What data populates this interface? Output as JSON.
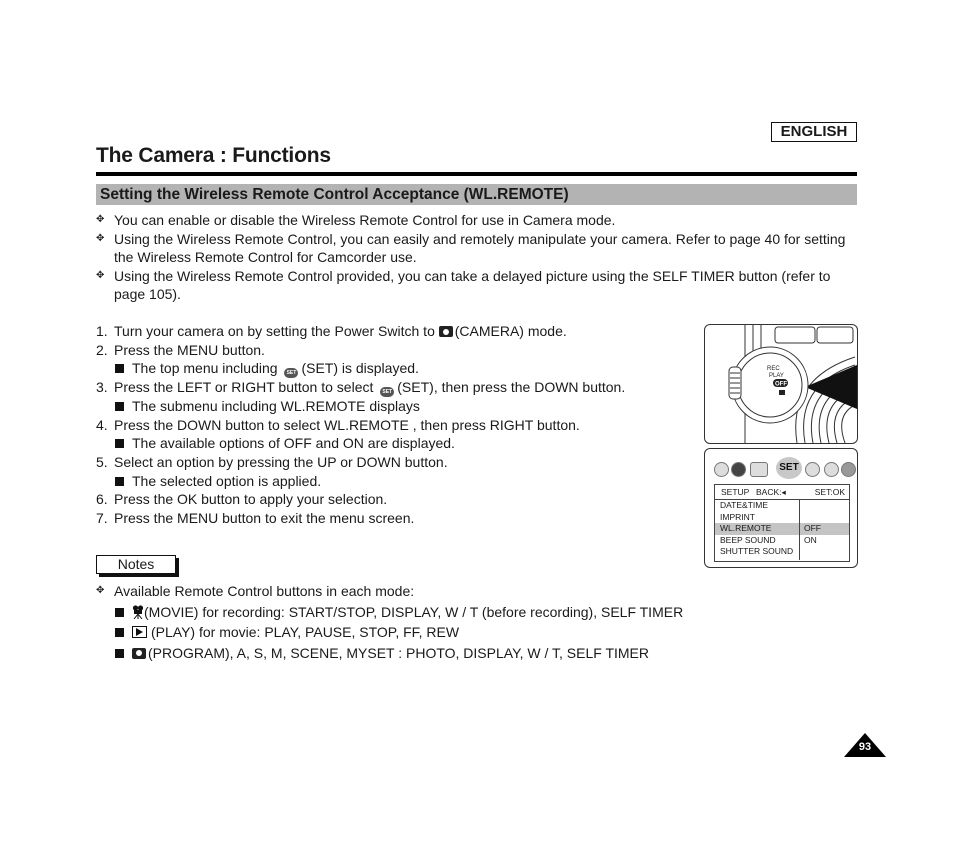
{
  "header": {
    "language_badge": "ENGLISH",
    "page_title": "The Camera : Functions",
    "section_title": "Setting the Wireless Remote Control Acceptance (WL.REMOTE)"
  },
  "intro_bullets": [
    "You can enable or disable the Wireless Remote Control for use in Camera mode.",
    "Using the Wireless Remote Control, you can easily and remotely manipulate your camera. Refer to page 40 for setting the Wireless Remote Control for Camcorder use.",
    "Using the Wireless Remote Control provided, you can take a delayed picture using the SELF TIMER button (refer to page 105)."
  ],
  "bullet_icon": "four-point-star-icon",
  "steps": [
    {
      "num": "1.",
      "pre": "Turn your camera on by setting the Power Switch to ",
      "icon": "camera-icon",
      "post": "(CAMERA) mode."
    },
    {
      "num": "2.",
      "text": "Press the MENU button."
    },
    {
      "sub": true,
      "pre": "The top menu including ",
      "icon": "set-icon",
      "post": "(SET) is displayed."
    },
    {
      "num": "3.",
      "pre": "Press the LEFT or RIGHT button to select ",
      "icon": "set-icon",
      "post": "(SET), then press the DOWN button."
    },
    {
      "sub": true,
      "text": "The submenu including  WL.REMOTE  displays"
    },
    {
      "num": "4.",
      "text": "Press the DOWN button to select  WL.REMOTE , then press RIGHT button."
    },
    {
      "sub": true,
      "text": "The available options of  OFF  and  ON  are displayed."
    },
    {
      "num": "5.",
      "text": "Select an option by pressing the UP or DOWN button."
    },
    {
      "sub": true,
      "text": "The selected option is applied."
    },
    {
      "num": "6.",
      "text": "Press the OK button to apply your selection."
    },
    {
      "num": "7.",
      "text": "Press the MENU button to exit the menu screen."
    }
  ],
  "set_icon_label": "SET",
  "notes": {
    "label": "Notes",
    "intro": "Available Remote Control buttons in each mode:",
    "items": [
      {
        "icon": "movie-camera-icon",
        "text": "(MOVIE) for recording: START/STOP, DISPLAY, W / T (before recording), SELF TIMER"
      },
      {
        "icon": "play-icon",
        "text": "(PLAY) for movie: PLAY, PAUSE, STOP, FF, REW"
      },
      {
        "icon": "camera-icon",
        "text": "(PROGRAM), A, S, M, SCENE, MYSET : PHOTO, DISPLAY, W / T, SELF TIMER"
      }
    ]
  },
  "camera_illustration": {
    "dial_labels": [
      "REC",
      "PLAY",
      "OFF"
    ]
  },
  "menu_screen": {
    "top_icons": [
      "camera-mode-icon",
      "self-timer-icon",
      "display-icon",
      "SET",
      "user-icon",
      "volume-icon",
      "grid-icon"
    ],
    "header_setup": "SETUP",
    "header_back": "BACK:◂",
    "header_ok": "SET:OK",
    "items": [
      "DATE&TIME",
      "IMPRINT",
      "WL.REMOTE",
      "BEEP SOUND",
      "SHUTTER SOUND"
    ],
    "selected_item": "WL.REMOTE",
    "options": [
      "OFF",
      "ON"
    ],
    "selected_option": "OFF"
  },
  "page_number": "93"
}
